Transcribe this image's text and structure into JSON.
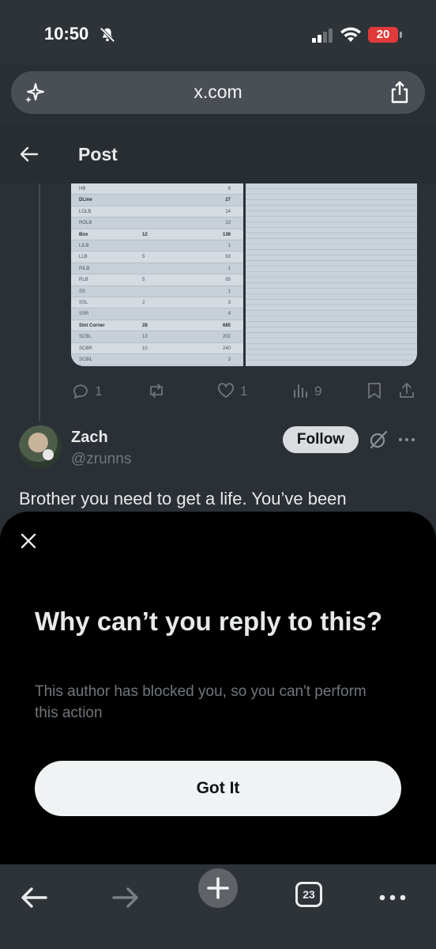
{
  "status_bar": {
    "time": "10:50",
    "battery": "20"
  },
  "browser": {
    "url": "x.com",
    "tab_count": "23"
  },
  "header": {
    "title": "Post"
  },
  "media_table": [
    {
      "label": "HB",
      "a": "",
      "b": "8",
      "bold": false
    },
    {
      "label": "DLine",
      "a": "",
      "b": "27",
      "bold": true
    },
    {
      "label": "LOLB",
      "a": "",
      "b": "14",
      "bold": false
    },
    {
      "label": "ROLB",
      "a": "",
      "b": "13",
      "bold": false
    },
    {
      "label": "Box",
      "a": "12",
      "b": "138",
      "bold": true
    },
    {
      "label": "LILB",
      "a": "",
      "b": "1",
      "bold": false
    },
    {
      "label": "LLB",
      "a": "5",
      "b": "63",
      "bold": false
    },
    {
      "label": "RILB",
      "a": "",
      "b": "1",
      "bold": false
    },
    {
      "label": "RLB",
      "a": "5",
      "b": "65",
      "bold": false
    },
    {
      "label": "SS",
      "a": "",
      "b": "1",
      "bold": false
    },
    {
      "label": "SSL",
      "a": "2",
      "b": "3",
      "bold": false
    },
    {
      "label": "SSR",
      "a": "",
      "b": "4",
      "bold": false
    },
    {
      "label": "Slot Corner",
      "a": "28",
      "b": "685",
      "bold": true
    },
    {
      "label": "SCBL",
      "a": "13",
      "b": "202",
      "bold": false
    },
    {
      "label": "SCBR",
      "a": "10",
      "b": "240",
      "bold": false
    },
    {
      "label": "SCBiL",
      "a": "",
      "b": "3",
      "bold": false
    }
  ],
  "post_actions": {
    "replies": "1",
    "likes": "1",
    "views": "9"
  },
  "reply": {
    "name": "Zach",
    "handle": "@zrunns",
    "follow_label": "Follow",
    "text": "Brother you need to get a life. You’ve been"
  },
  "sheet": {
    "title": "Why can’t you reply to this?",
    "body": "This author has blocked you, so you can't perform this action",
    "button": "Got It"
  },
  "colors": {
    "accent_button": "#eff3f4",
    "muted_text": "#71767b",
    "battery_low": "#e03a3a"
  },
  "icons": [
    "bell-slash-icon",
    "signal-icon",
    "wifi-icon",
    "sparkle-icon",
    "share-icon",
    "back-arrow-icon",
    "reply-icon",
    "repost-icon",
    "like-icon",
    "views-icon",
    "bookmark-icon",
    "grok-icon",
    "more-icon",
    "close-icon",
    "plus-icon",
    "tabs-icon"
  ]
}
